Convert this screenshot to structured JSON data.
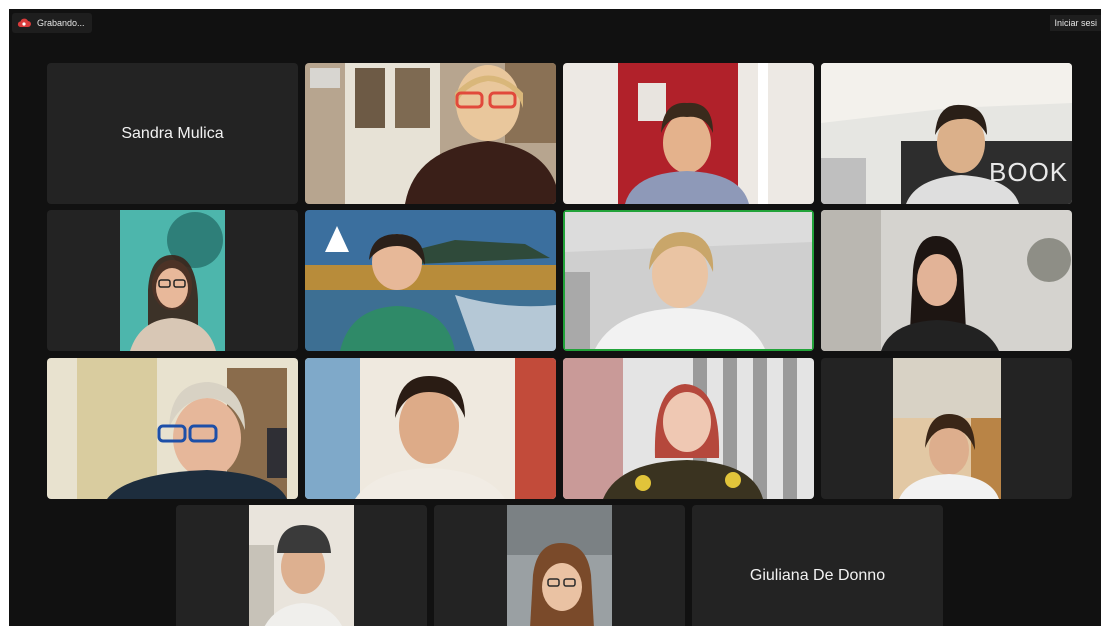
{
  "recording": {
    "label": "Grabando...",
    "icon": "cloud-recording-icon",
    "color": "#d93b3b"
  },
  "header": {
    "login_label": "Iniciar sesi"
  },
  "active_speaker_color": "#22a33a",
  "participants": [
    {
      "id": "p1",
      "display_name": "Sandra Mulica",
      "video": false
    },
    {
      "id": "p2",
      "video": true
    },
    {
      "id": "p3",
      "video": true
    },
    {
      "id": "p4",
      "video": true,
      "background_text": "BOOK"
    },
    {
      "id": "p5",
      "video": true
    },
    {
      "id": "p6",
      "video": true
    },
    {
      "id": "p7",
      "video": true,
      "active_speaker": true
    },
    {
      "id": "p8",
      "video": true
    },
    {
      "id": "p9",
      "video": true
    },
    {
      "id": "p10",
      "video": true
    },
    {
      "id": "p11",
      "video": true
    },
    {
      "id": "p12",
      "video": true
    },
    {
      "id": "p13",
      "video": true
    },
    {
      "id": "p14",
      "video": true
    },
    {
      "id": "p15",
      "display_name": "Giuliana De Donno",
      "video": false
    }
  ]
}
